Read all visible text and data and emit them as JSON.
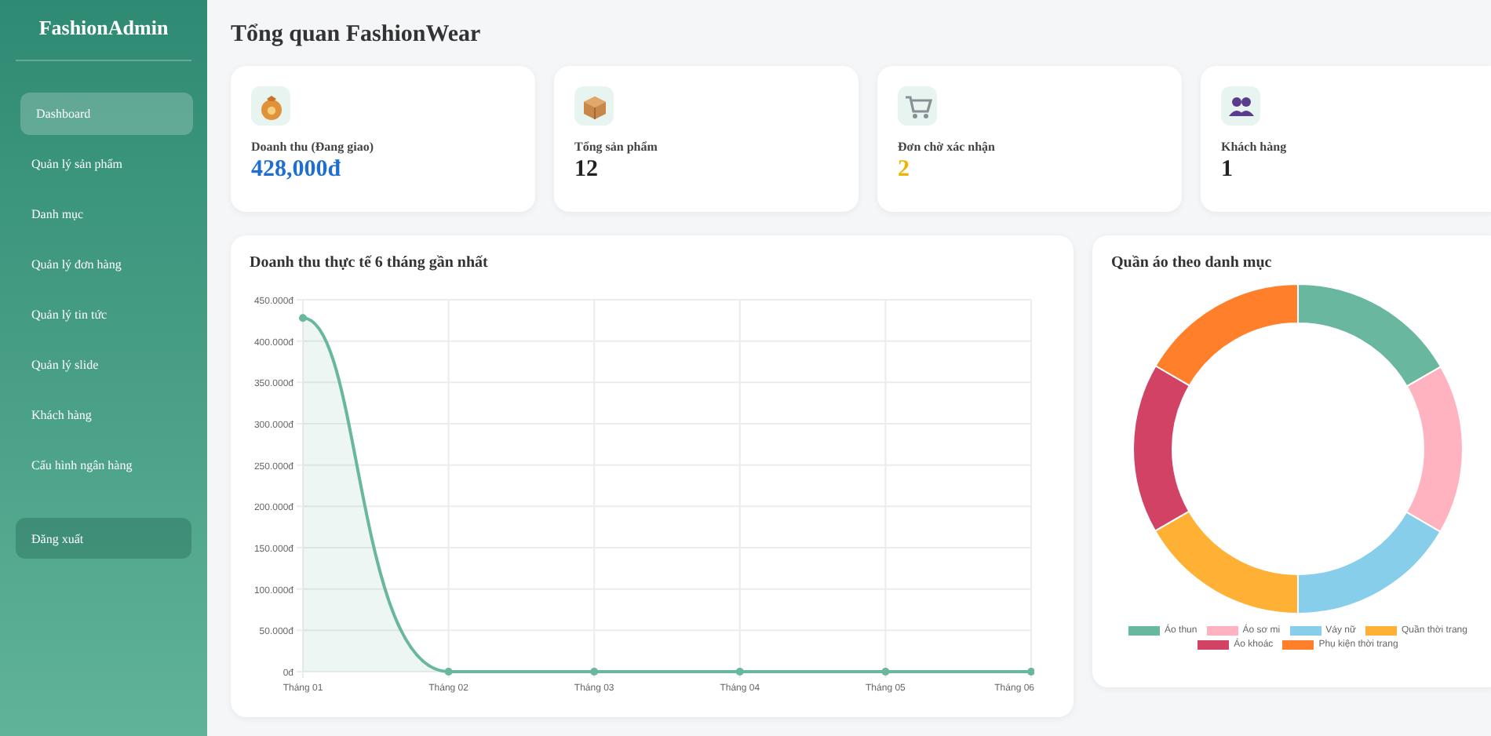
{
  "sidebar": {
    "brand": "FashionAdmin",
    "items": [
      {
        "label": "Dashboard",
        "selected": true
      },
      {
        "label": "Quản lý sản phẩm",
        "selected": false
      },
      {
        "label": "Danh mục",
        "selected": false
      },
      {
        "label": "Quản lý đơn hàng",
        "selected": false
      },
      {
        "label": "Quản lý tin tức",
        "selected": false
      },
      {
        "label": "Quản lý slide",
        "selected": false
      },
      {
        "label": "Khách hàng",
        "selected": false
      },
      {
        "label": "Cấu hình ngân hàng",
        "selected": false
      }
    ],
    "logout": "Đăng xuất"
  },
  "page_title": "Tổng quan FashionWear",
  "stats": [
    {
      "kind": "money",
      "label": "Doanh thu (Đang giao)",
      "value": "428,000đ",
      "color": "#1f6fd1"
    },
    {
      "kind": "box",
      "label": "Tổng sản phẩm",
      "value": "12",
      "color": "#222222"
    },
    {
      "kind": "cart",
      "label": "Đơn chờ xác nhận",
      "value": "2",
      "color": "#f0b400"
    },
    {
      "kind": "people",
      "label": "Khách hàng",
      "value": "1",
      "color": "#222222"
    }
  ],
  "revenue_chart": {
    "title": "Doanh thu thực tế 6 tháng gần nhất",
    "chart_data": {
      "type": "area",
      "categories": [
        "Tháng 01",
        "Tháng 02",
        "Tháng 03",
        "Tháng 04",
        "Tháng 05",
        "Tháng 06"
      ],
      "series": [
        {
          "color": "#6ab7a0",
          "values": [
            428000,
            0,
            0,
            0,
            0,
            0
          ]
        }
      ],
      "grid": true,
      "ylim": [
        0,
        450000
      ],
      "yticks": [
        {
          "value": 0,
          "label": "0đ"
        },
        {
          "value": 50000,
          "label": "50.000đ"
        },
        {
          "value": 100000,
          "label": "100.000đ"
        },
        {
          "value": 150000,
          "label": "150.000đ"
        },
        {
          "value": 200000,
          "label": "200.000đ"
        },
        {
          "value": 250000,
          "label": "250.000đ"
        },
        {
          "value": 300000,
          "label": "300.000đ"
        },
        {
          "value": 350000,
          "label": "350.000đ"
        },
        {
          "value": 400000,
          "label": "400.000đ"
        },
        {
          "value": 450000,
          "label": "450.000đ"
        }
      ]
    }
  },
  "category_chart": {
    "title": "Quần áo theo danh mục",
    "chart_data": {
      "type": "donut",
      "categories": [
        "Áo thun",
        "Áo sơ mi",
        "Váy nữ",
        "Quần thời trang",
        "Áo khoác",
        "Phụ kiện thời trang"
      ],
      "series": [
        {
          "colors": [
            "#6ab7a0",
            "#ffb3c1",
            "#87ceeb",
            "#ffb135",
            "#d14265",
            "#ff7f2a"
          ],
          "values": [
            16.7,
            16.7,
            16.6,
            16.7,
            16.7,
            16.6
          ]
        }
      ]
    }
  }
}
